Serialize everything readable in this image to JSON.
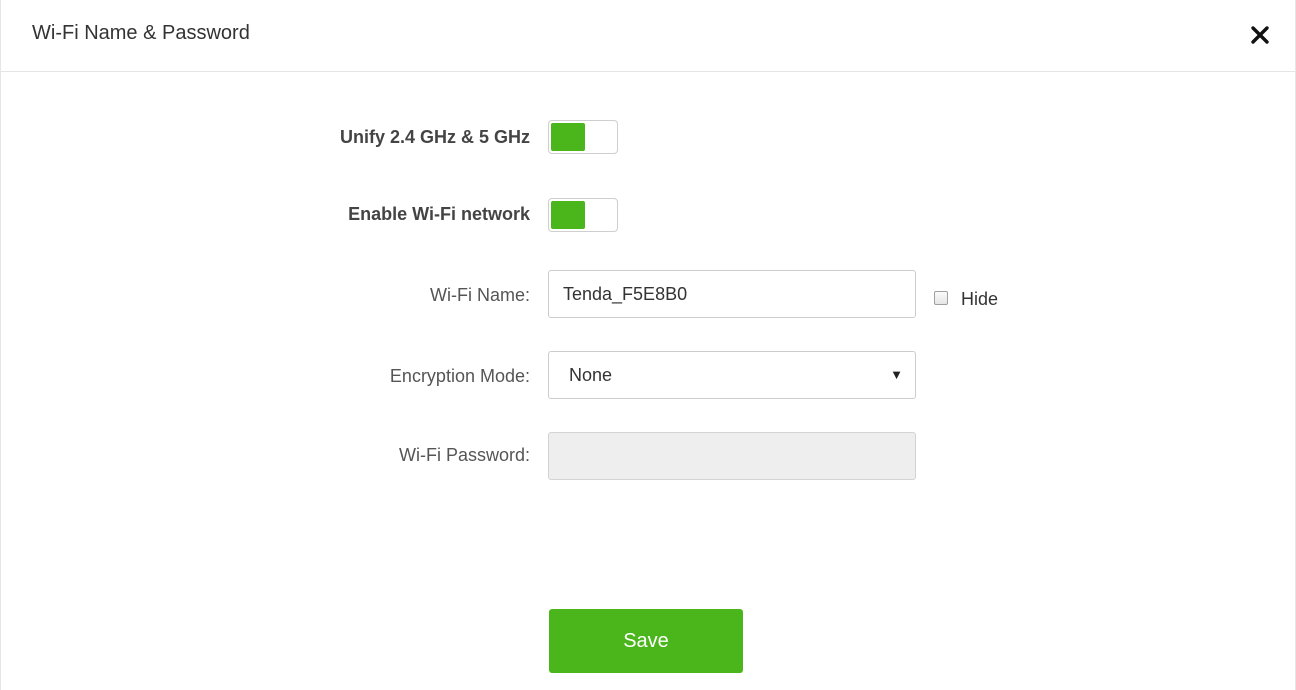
{
  "dialog": {
    "title": "Wi-Fi Name & Password",
    "close_icon": "close-icon"
  },
  "form": {
    "unify": {
      "label": "Unify 2.4 GHz & 5 GHz",
      "enabled": true
    },
    "enable_wifi": {
      "label": "Enable Wi-Fi network",
      "enabled": true
    },
    "wifi_name": {
      "label": "Wi-Fi Name:",
      "value": "Tenda_F5E8B0",
      "hide_label": "Hide",
      "hide_checked": false
    },
    "encryption": {
      "label": "Encryption Mode:",
      "value": "None"
    },
    "password": {
      "label": "Wi-Fi Password:",
      "value": "",
      "disabled": true
    }
  },
  "actions": {
    "save_label": "Save"
  },
  "colors": {
    "accent": "#4bb51c",
    "disabled_bg": "#eeeeee",
    "text": "#333333"
  }
}
